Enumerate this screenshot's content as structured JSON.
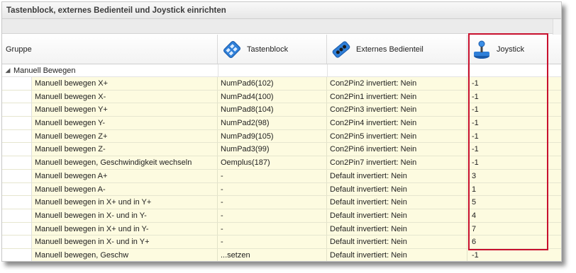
{
  "window": {
    "title": "Tastenblock, externes Bedienteil und Joystick einrichten"
  },
  "columns": {
    "group": "Gruppe",
    "keypad": "Tastenblock",
    "external": "Externes Bedienteil",
    "joystick": "Joystick"
  },
  "icons": {
    "keypad": "keypad-icon",
    "external": "control-panel-icon",
    "joystick": "joystick-icon",
    "expand": "collapse-arrow-icon"
  },
  "group_row": {
    "expand_glyph": "◢",
    "label": "Manuell Bewegen"
  },
  "rows": [
    {
      "name": "Manuell bewegen X+",
      "keypad": "NumPad6(102)",
      "external": "Con2Pin2 invertiert: Nein",
      "joystick": "-1"
    },
    {
      "name": "Manuell bewegen X-",
      "keypad": "NumPad4(100)",
      "external": "Con2Pin1 invertiert: Nein",
      "joystick": "-1"
    },
    {
      "name": "Manuell bewegen Y+",
      "keypad": "NumPad8(104)",
      "external": "Con2Pin3 invertiert: Nein",
      "joystick": "-1"
    },
    {
      "name": "Manuell bewegen Y-",
      "keypad": "NumPad2(98)",
      "external": "Con2Pin4 invertiert: Nein",
      "joystick": "-1"
    },
    {
      "name": "Manuell bewegen Z+",
      "keypad": "NumPad9(105)",
      "external": "Con2Pin5 invertiert: Nein",
      "joystick": "-1"
    },
    {
      "name": "Manuell bewegen Z-",
      "keypad": "NumPad3(99)",
      "external": "Con2Pin6 invertiert: Nein",
      "joystick": "-1"
    },
    {
      "name": "Manuell bewegen, Geschwindigkeit wechseln",
      "keypad": "Oemplus(187)",
      "external": "Con2Pin7 invertiert: Nein",
      "joystick": "-1"
    },
    {
      "name": "Manuell bewegen A+",
      "keypad": "-",
      "external": "Default invertiert: Nein",
      "joystick": "3"
    },
    {
      "name": "Manuell bewegen A-",
      "keypad": "-",
      "external": "Default invertiert: Nein",
      "joystick": "1"
    },
    {
      "name": "Manuell bewegen in X+ und in Y+",
      "keypad": "-",
      "external": "Default invertiert: Nein",
      "joystick": "5"
    },
    {
      "name": "Manuell bewegen in X- und in Y-",
      "keypad": "-",
      "external": "Default invertiert: Nein",
      "joystick": "4"
    },
    {
      "name": "Manuell bewegen in X+ und in Y-",
      "keypad": "-",
      "external": "Default invertiert: Nein",
      "joystick": "7"
    },
    {
      "name": "Manuell bewegen in X- und in Y+",
      "keypad": "-",
      "external": "Default invertiert: Nein",
      "joystick": "6"
    },
    {
      "name": "Manuell bewegen, Geschw",
      "keypad": "...setzen",
      "external": "Default invertiert: Nein",
      "joystick": "-1"
    }
  ],
  "colors": {
    "row_background": "#fdfbe0",
    "highlight_border": "#c8102e"
  }
}
